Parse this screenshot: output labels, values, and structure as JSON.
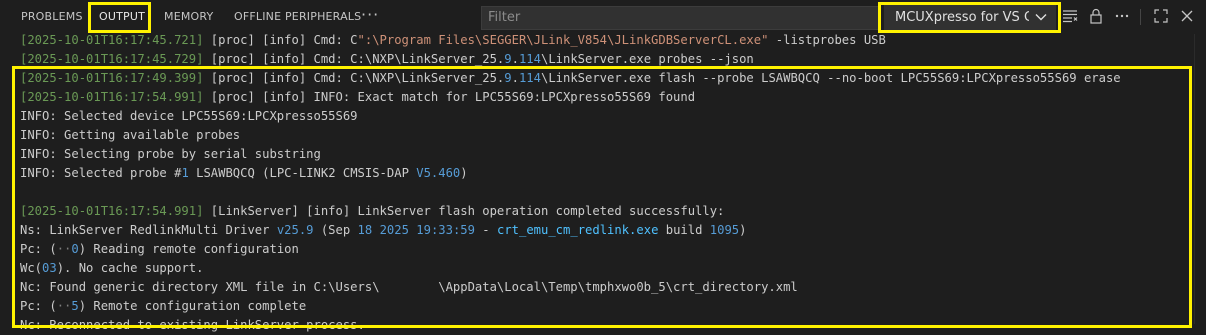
{
  "tabs": [
    {
      "label": "PROBLEMS"
    },
    {
      "label": "OUTPUT"
    },
    {
      "label": "MEMORY"
    },
    {
      "label": "OFFLINE PERIPHERALS"
    }
  ],
  "more": "···",
  "filter": {
    "placeholder": "Filter"
  },
  "channel": {
    "selected": "MCUXpresso for VS Code"
  },
  "icons": [
    "list-filter-icon",
    "lock-icon",
    "more-actions-icon",
    "maximize-icon",
    "close-icon"
  ],
  "highlight_color": "#fff200",
  "lines": {
    "l1": {
      "ts": "[2025-10-01T16:17:45.721]",
      "a": " [proc] [info] Cmd: C",
      "s": "\":\\Program Files\\SEGGER\\JLink_V854\\JLinkGDBServerCL.exe\"",
      "b": " -listprobes USB"
    },
    "l2": {
      "ts": "[2025-10-01T16:17:45.729]",
      "a": " [proc] [info] Cmd: C:\\NXP\\LinkServer_25.",
      "n1": "9",
      "dot": ".",
      "n2": "114",
      "b": "\\LinkServer.exe probes --json"
    },
    "l3": {
      "ts": "[2025-10-01T16:17:49.399]",
      "a": " [proc] [info] Cmd: C:\\NXP\\LinkServer_25.",
      "n1": "9",
      "dot": ".",
      "n2": "114",
      "b": "\\LinkServer.exe flash --probe LSAWBQCQ --no-boot LPC55S69:LPCXpresso55S69 erase"
    },
    "l4": {
      "ts": "[2025-10-01T16:17:54.991]",
      "a": " [proc] [info] INFO: Exact match for LPC55S69:LPCXpresso55S69 found"
    },
    "l5": {
      "a": "INFO: Selected device LPC55S69:LPCXpresso55S69"
    },
    "l6": {
      "a": "INFO: Getting available probes"
    },
    "l7": {
      "a": "INFO: Selecting probe by serial substring"
    },
    "l8": {
      "a": "INFO: Selected probe #",
      "n1": "1",
      "b": " LSAWBQCQ (LPC-LINK2 CMSIS-DAP ",
      "v": "V5.460",
      "c": ")"
    },
    "l9": {
      "ts": "[2025-10-01T16:17:54.991]",
      "a": " [LinkServer] [info] LinkServer flash operation completed successfully:"
    },
    "l10": {
      "a": "Ns: LinkServer RedlinkMulti Driver ",
      "v": "v25.9",
      "b": " (Sep ",
      "n1": "18",
      "sp": " ",
      "n2": "2025",
      "sp2": " ",
      "t": "19:33:59",
      "c": " - ",
      "lk": "crt_emu_cm_redlink.exe",
      "d": " build ",
      "n3": "1095",
      "e": ")"
    },
    "l11": {
      "a": "Pc: (",
      "dots": "··",
      "n1": "0",
      "b": ") Reading remote configuration"
    },
    "l12": {
      "a": "Wc(",
      "n1": "03",
      "b": "). No cache support."
    },
    "l13": {
      "a": "Nc: Found generic directory XML file in C:\\Users\\        \\AppData\\Local\\Temp\\tmphxwo0b_5\\crt_directory.xml"
    },
    "l14": {
      "a": "Pc: (",
      "dots": "··",
      "n1": "5",
      "b": ") Remote configuration complete"
    },
    "l15": {
      "a": "Nc: Reconnected to existing LinkServer process."
    }
  }
}
